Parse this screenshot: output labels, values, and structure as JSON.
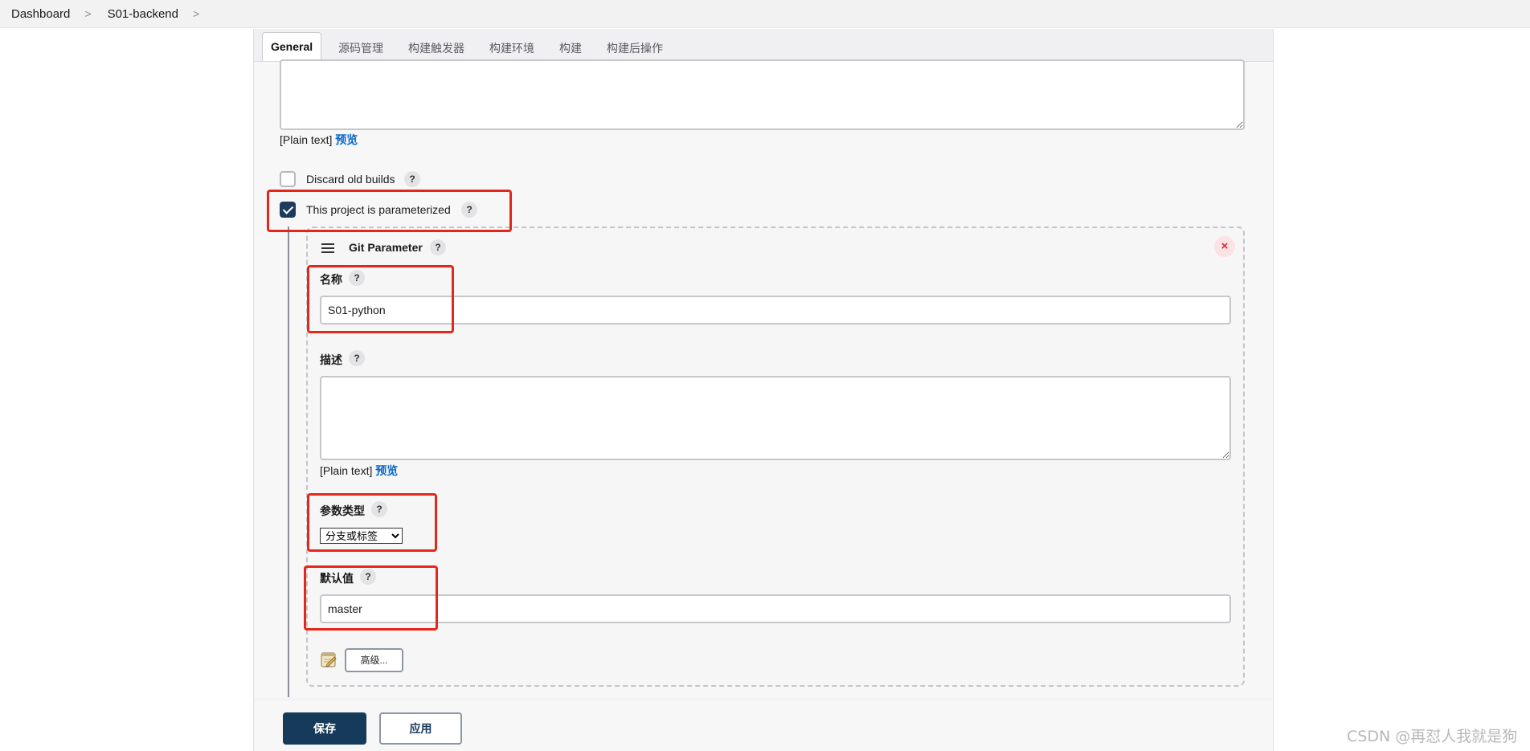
{
  "breadcrumb": {
    "items": [
      "Dashboard",
      "S01-backend"
    ],
    "separator": ">"
  },
  "tabs": [
    {
      "label": "General",
      "active": true
    },
    {
      "label": "源码管理"
    },
    {
      "label": "构建触发器"
    },
    {
      "label": "构建环境"
    },
    {
      "label": "构建"
    },
    {
      "label": "构建后操作"
    }
  ],
  "description": {
    "value": "",
    "format_text": "[Plain text]",
    "preview_link": "预览"
  },
  "options": {
    "discard_old_builds": {
      "label": "Discard old builds",
      "checked": false
    },
    "parameterized": {
      "label": "This project is parameterized",
      "checked": true
    }
  },
  "help_label": "?",
  "git_parameter": {
    "title": "Git Parameter",
    "remove_icon": "×",
    "name_label": "名称",
    "name_value": "S01-python",
    "desc_label": "描述",
    "desc_value": "",
    "desc_format_text": "[Plain text]",
    "desc_preview_link": "预览",
    "type_label": "参数类型",
    "type_value": "分支或标签",
    "default_label": "默认值",
    "default_value": "master",
    "advanced_button": "高级..."
  },
  "footer": {
    "save": "保存",
    "apply": "应用"
  },
  "watermark": "CSDN @再怼人我就是狗",
  "colors": {
    "primary": "#163a5a",
    "link": "#0b67c7",
    "highlight": "#e5261a"
  }
}
